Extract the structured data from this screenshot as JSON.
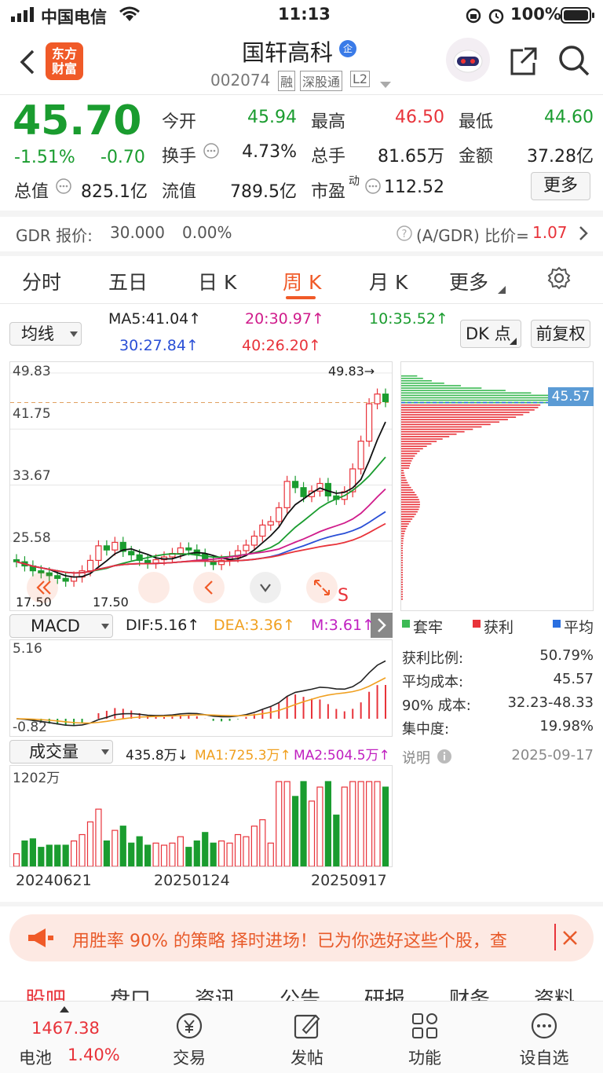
{
  "status": {
    "carrier": "中国电信",
    "time": "11:13",
    "battery": "100%"
  },
  "header": {
    "logo_line1": "东方",
    "logo_line2": "财富",
    "title": "国轩高科",
    "badge": "企",
    "code": "002074",
    "tags": [
      "融",
      "深股通",
      "L2"
    ]
  },
  "quote": {
    "price": "45.70",
    "pct": "-1.51%",
    "change": "-0.70",
    "open_label": "今开",
    "open": "45.94",
    "high_label": "最高",
    "high": "46.50",
    "low_label": "最低",
    "low": "44.60",
    "turnover_label": "换手",
    "turnover": "4.73%",
    "volume_label": "总手",
    "volume": "81.65万",
    "amount_label": "金额",
    "amount": "37.28亿",
    "mktcap_label": "总值",
    "mktcap": "825.1亿",
    "float_label": "流值",
    "float": "789.5亿",
    "pe_label": "市盈",
    "pe_sup": "动",
    "pe": "112.52",
    "more": "更多"
  },
  "gdr": {
    "label": "GDR 报价:",
    "price": "30.000",
    "pct": "0.00%",
    "ratio_label": "(A/GDR) 比价=",
    "ratio": "1.07"
  },
  "tabs": [
    "分时",
    "五日",
    "日 K",
    "周 K",
    "月 K",
    "更多"
  ],
  "ma": {
    "selector": "均线",
    "ma5": "MA5:41.04↑",
    "ma20": "20:30.97↑",
    "ma10": "10:35.52↑",
    "ma30": "30:27.84↑",
    "ma40": "40:26.20↑",
    "dk": "DK 点",
    "fq": "前复权"
  },
  "chart_data": {
    "type": "line",
    "title": "",
    "y_ticks": [
      "49.83",
      "41.75",
      "33.67",
      "25.58"
    ],
    "high_marker": "49.83→",
    "low_marker": "17.50",
    "low_marker_left": "17.50",
    "signal": "S",
    "cost_line_value": "45.57",
    "dates": [
      "20240621",
      "20250124",
      "20250917"
    ],
    "close": [
      22.6,
      22.0,
      21.3,
      21.0,
      20.6,
      20.2,
      19.8,
      20.4,
      21.3,
      22.8,
      24.9,
      24.3,
      25.4,
      24.1,
      23.6,
      22.8,
      22.4,
      22.9,
      23.3,
      23.8,
      24.6,
      24.3,
      23.7,
      22.7,
      22.2,
      22.8,
      23.3,
      24.2,
      25.0,
      26.3,
      27.9,
      28.4,
      30.4,
      34.2,
      33.3,
      32.0,
      32.8,
      33.9,
      32.1,
      31.6,
      32.7,
      36.0,
      40.0,
      45.4,
      46.8,
      45.7
    ],
    "macd": {
      "dif": "DIF:5.16↑",
      "dea": "DEA:3.36↑",
      "m": "M:3.61↑",
      "top": "5.16",
      "bottom": "-0.82"
    },
    "volume": {
      "label": "成交量",
      "current": "435.8万↓",
      "ma1": "MA1:725.3万↑",
      "ma2": "MA2:504.5万↑",
      "top": "1202万"
    }
  },
  "chips": {
    "legend": [
      "套牢",
      "获利",
      "平均"
    ],
    "rows": [
      {
        "label": "获利比例:",
        "value": "50.79%"
      },
      {
        "label": "平均成本:",
        "value": "45.57"
      },
      {
        "label": "90% 成本:",
        "value": "32.23-48.33"
      },
      {
        "label": "集中度:",
        "value": "19.98%"
      }
    ],
    "note": "说明",
    "date": "2025-09-17"
  },
  "banner": {
    "text": "用胜率 90% 的策略 择时进场！已为你选好这些个股，查"
  },
  "subtabs": [
    "股吧",
    "盘口",
    "资讯",
    "公告",
    "研报",
    "财务",
    "资料"
  ],
  "bottom": {
    "index": "1467.38",
    "index_label": "电池",
    "index_pct": "1.40%",
    "items": [
      "交易",
      "发帖",
      "功能",
      "设自选"
    ]
  }
}
